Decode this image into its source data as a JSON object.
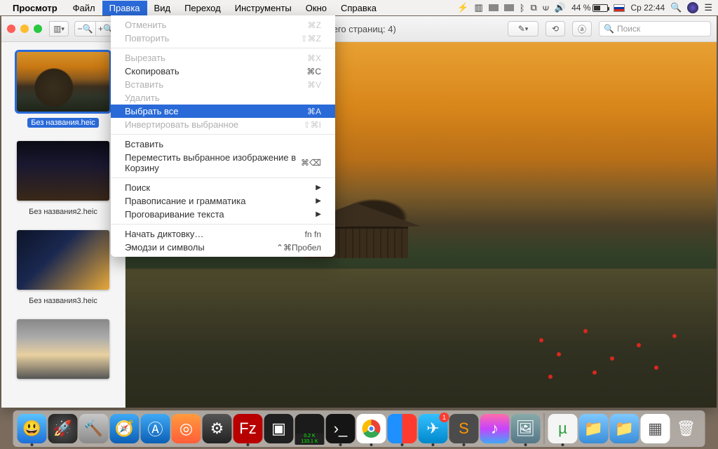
{
  "menubar": {
    "app": "Просмотр",
    "items": [
      "Файл",
      "Правка",
      "Вид",
      "Переход",
      "Инструменты",
      "Окно",
      "Справка"
    ],
    "active_index": 1,
    "right": {
      "battery_pct": "44 %",
      "clock": "Ср 22:44"
    }
  },
  "dropdown": {
    "groups": [
      [
        {
          "label": "Отменить",
          "shortcut": "⌘Z",
          "disabled": true
        },
        {
          "label": "Повторить",
          "shortcut": "⇧⌘Z",
          "disabled": true
        }
      ],
      [
        {
          "label": "Вырезать",
          "shortcut": "⌘X",
          "disabled": true
        },
        {
          "label": "Скопировать",
          "shortcut": "⌘C"
        },
        {
          "label": "Вставить",
          "shortcut": "⌘V",
          "disabled": true
        },
        {
          "label": "Удалить",
          "shortcut": "",
          "disabled": true
        },
        {
          "label": "Выбрать все",
          "shortcut": "⌘A",
          "selected": true
        },
        {
          "label": "Инвертировать выбранное",
          "shortcut": "⇧⌘I",
          "disabled": true
        }
      ],
      [
        {
          "label": "Вставить",
          "shortcut": ""
        },
        {
          "label": "Переместить выбранное изображение в Корзину",
          "shortcut": "⌘⌫"
        }
      ],
      [
        {
          "label": "Поиск",
          "submenu": true
        },
        {
          "label": "Правописание и грамматика",
          "submenu": true
        },
        {
          "label": "Проговаривание текста",
          "submenu": true
        }
      ],
      [
        {
          "label": "Начать диктовку…",
          "shortcut": "fn fn"
        },
        {
          "label": "Эмодзи и символы",
          "shortcut": "⌃⌘Пробел"
        }
      ]
    ]
  },
  "window": {
    "title_suffix": "(документов: 4, всего страниц: 4)",
    "search_placeholder": "Поиск"
  },
  "sidebar": {
    "thumbs": [
      {
        "label": "Без названия.heic",
        "selected": true,
        "img": "autumn"
      },
      {
        "label": "Без названия2.heic",
        "img": "city"
      },
      {
        "label": "Без названия3.heic",
        "img": "city2"
      },
      {
        "label": "",
        "img": "street"
      }
    ]
  },
  "dock": {
    "net_up": "0.2 K",
    "net_down": "133.1 K",
    "telegram_badge": "1"
  }
}
